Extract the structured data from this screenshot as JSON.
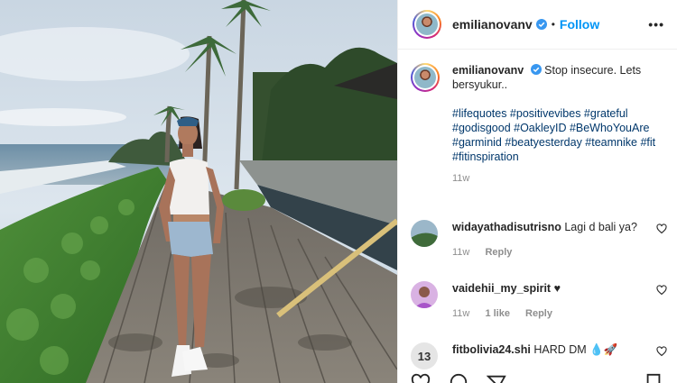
{
  "post": {
    "username": "emilianovanv",
    "follow_label": "Follow",
    "separator": "•",
    "more_label": "•••"
  },
  "caption": {
    "username": "emilianovanv",
    "text": "Stop insecure. Lets bersyukur..",
    "hashtags": "#lifequotes #positivevibes #grateful #godisgood #OakleyID #BeWhoYouAre #garminid #beatyesterday #teamnike #fit #fitinspiration",
    "time": "11w"
  },
  "comments": [
    {
      "username": "widayathadisutrisno",
      "text": "Lagi d bali ya?",
      "time": "11w",
      "reply_label": "Reply"
    },
    {
      "username": "vaidehii_my_spirit",
      "text": "♥",
      "time": "11w",
      "likes_label": "1 like",
      "reply_label": "Reply"
    },
    {
      "username": "fitbolivia24.shi",
      "text": "HARD DM 💧🚀",
      "avatar_text": "13"
    }
  ],
  "colors": {
    "follow": "#0095f6",
    "hashtag": "#00376b",
    "muted": "#8e8e8e",
    "verified": "#3897f0"
  }
}
